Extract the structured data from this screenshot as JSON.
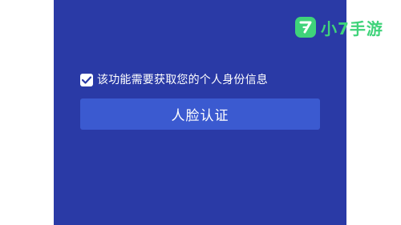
{
  "consent": {
    "checked": true,
    "label": "该功能需要获取您的个人身份信息"
  },
  "actions": {
    "verify_label": "人脸认证"
  },
  "watermark": {
    "brand": "小7手游",
    "icon": "seven-logo-icon"
  },
  "colors": {
    "panel_bg": "#2a3aa6",
    "button_bg": "#3b5ad0",
    "brand_green": "#3fd37a",
    "checkbox_mark": "#2a3aa6"
  }
}
